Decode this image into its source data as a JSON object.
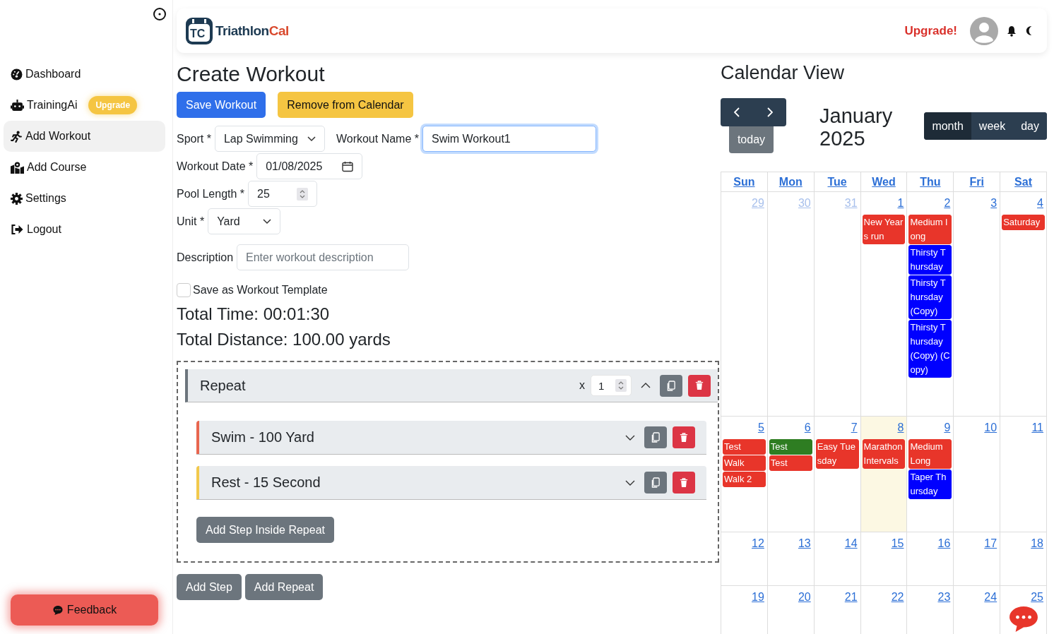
{
  "sidebar": {
    "items": [
      {
        "label": "Dashboard",
        "selected": false
      },
      {
        "label": "TrainingAi",
        "selected": false,
        "badge": "Upgrade"
      },
      {
        "label": "Add Workout",
        "selected": true
      },
      {
        "label": "Add Course",
        "selected": false
      },
      {
        "label": "Settings",
        "selected": false
      },
      {
        "label": "Logout",
        "selected": false
      }
    ],
    "feedback": "Feedback"
  },
  "header": {
    "logo_mark": "TC",
    "logo_first": "Triathlon",
    "logo_second": "Cal",
    "upgrade": "Upgrade!"
  },
  "form": {
    "title": "Create Workout",
    "buttons": [
      {
        "label": "Save Workout",
        "kind": "primary"
      },
      {
        "label": "Remove from Calendar",
        "kind": "warning"
      }
    ],
    "sport": {
      "label": "Sport *",
      "value": "Lap Swimming"
    },
    "workout_name": {
      "label": "Workout Name *",
      "value": "Swim Workout1"
    },
    "workout_date": {
      "label": "Workout Date *",
      "value": "01/08/2025"
    },
    "pool_length": {
      "label": "Pool Length *",
      "value": "25"
    },
    "unit": {
      "label": "Unit *",
      "value": "Yard"
    },
    "description": {
      "label": "Description",
      "placeholder": "Enter workout description"
    },
    "template": {
      "label": "Save as Workout Template",
      "checked": false
    },
    "total_time": "Total Time: 00:01:30",
    "total_distance": "Total Distance: 100.00 yards"
  },
  "repeat": {
    "title": "Repeat",
    "times_prefix": "x",
    "times": "1",
    "expanded": true,
    "steps": [
      {
        "title": "Swim - 100 Yard",
        "color": "#e8664f",
        "expanded": false
      },
      {
        "title": "Rest - 15 Second",
        "color": "#f2c94c",
        "expanded": false
      }
    ],
    "add_inside": "Add Step Inside Repeat"
  },
  "bottom_buttons": [
    "Add Step",
    "Add Repeat"
  ],
  "calendar": {
    "title": "Calendar View",
    "today": "today",
    "month": "January 2025",
    "views": [
      {
        "label": "month",
        "selected": true
      },
      {
        "label": "week",
        "selected": false
      },
      {
        "label": "day",
        "selected": false
      }
    ],
    "weekdays": [
      "Sun",
      "Mon",
      "Tue",
      "Wed",
      "Thu",
      "Fri",
      "Sat"
    ],
    "weeks": [
      [
        {
          "date": "29",
          "other_month": true,
          "today": false
        },
        {
          "date": "30",
          "other_month": true,
          "today": false
        },
        {
          "date": "31",
          "other_month": true,
          "today": false
        },
        {
          "date": "1",
          "other_month": false,
          "today": false,
          "events": [
            {
              "title": "New Years run",
              "color": "#e8352a"
            }
          ]
        },
        {
          "date": "2",
          "other_month": false,
          "today": false,
          "events": [
            {
              "title": "Medium long",
              "color": "#e8352a"
            },
            {
              "title": "Thirsty Thursday",
              "color": "#0000ff"
            },
            {
              "title": "Thirsty Thursday (Copy)",
              "color": "#0000ff"
            },
            {
              "title": "Thirsty Thursday (Copy) (Copy)",
              "color": "#0000ff"
            }
          ]
        },
        {
          "date": "3",
          "other_month": false,
          "today": false
        },
        {
          "date": "4",
          "other_month": false,
          "today": false,
          "events": [
            {
              "title": "Saturday",
              "color": "#e8352a"
            }
          ]
        }
      ],
      [
        {
          "date": "5",
          "other_month": false,
          "today": false,
          "events": [
            {
              "title": "Test",
              "color": "#e8352a"
            },
            {
              "title": "Walk",
              "color": "#e8352a"
            },
            {
              "title": "Walk 2",
              "color": "#e8352a"
            }
          ]
        },
        {
          "date": "6",
          "other_month": false,
          "today": false,
          "events": [
            {
              "title": "Test",
              "color": "#2e7d22"
            },
            {
              "title": "Test",
              "color": "#e8352a"
            }
          ]
        },
        {
          "date": "7",
          "other_month": false,
          "today": false,
          "events": [
            {
              "title": "Easy Tuesday",
              "color": "#e8352a"
            }
          ]
        },
        {
          "date": "8",
          "other_month": false,
          "today": true,
          "events": [
            {
              "title": "Marathon Intervals",
              "color": "#e8352a"
            }
          ]
        },
        {
          "date": "9",
          "other_month": false,
          "today": false,
          "events": [
            {
              "title": "Medium Long",
              "color": "#e8352a"
            },
            {
              "title": "Taper Thursday",
              "color": "#0000ff"
            }
          ]
        },
        {
          "date": "10",
          "other_month": false,
          "today": false
        },
        {
          "date": "11",
          "other_month": false,
          "today": false
        }
      ],
      [
        {
          "date": "12",
          "other_month": false,
          "today": false
        },
        {
          "date": "13",
          "other_month": false,
          "today": false
        },
        {
          "date": "14",
          "other_month": false,
          "today": false
        },
        {
          "date": "15",
          "other_month": false,
          "today": false
        },
        {
          "date": "16",
          "other_month": false,
          "today": false
        },
        {
          "date": "17",
          "other_month": false,
          "today": false
        },
        {
          "date": "18",
          "other_month": false,
          "today": false
        }
      ],
      [
        {
          "date": "19",
          "other_month": false,
          "today": false
        },
        {
          "date": "20",
          "other_month": false,
          "today": false
        },
        {
          "date": "21",
          "other_month": false,
          "today": false
        },
        {
          "date": "22",
          "other_month": false,
          "today": false
        },
        {
          "date": "23",
          "other_month": false,
          "today": false
        },
        {
          "date": "24",
          "other_month": false,
          "today": false
        },
        {
          "date": "25",
          "other_month": false,
          "today": false
        }
      ]
    ]
  }
}
